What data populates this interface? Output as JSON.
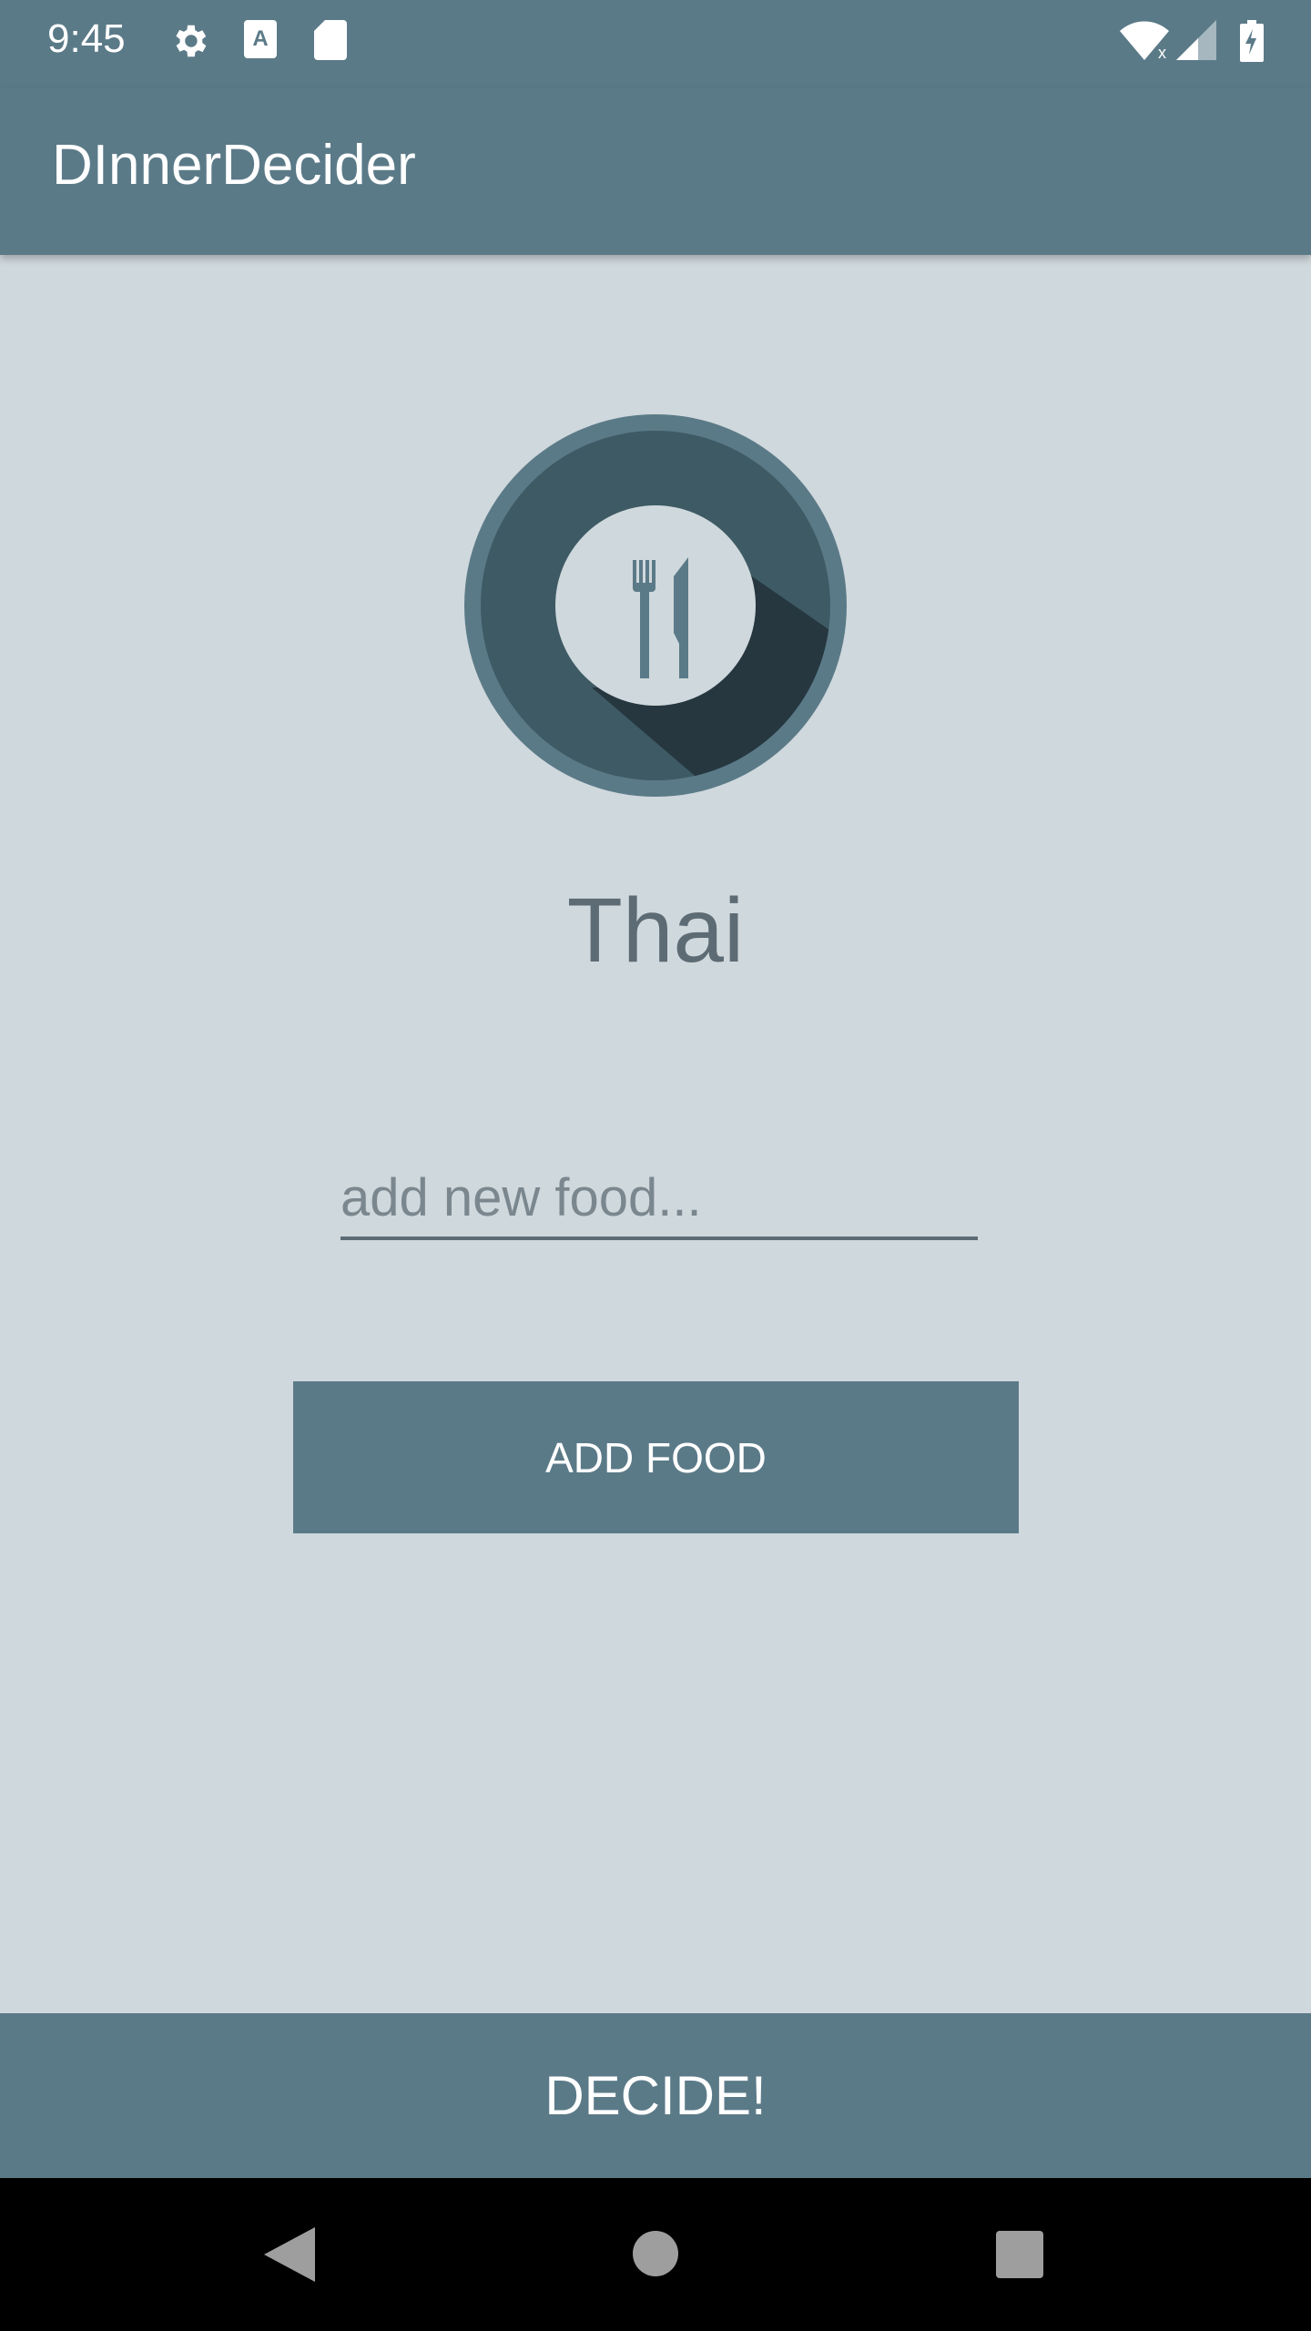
{
  "status_bar": {
    "time": "9:45",
    "icons": [
      "settings-icon",
      "font-a-icon",
      "sd-card-icon",
      "wifi-off-icon",
      "signal-icon",
      "battery-charging-icon"
    ]
  },
  "app_bar": {
    "title": "DInnerDecider"
  },
  "main": {
    "logo": "plate-fork-knife-icon",
    "selected_food": "Thai",
    "new_food_input": {
      "value": "",
      "placeholder": "add new food..."
    },
    "add_food_label": "ADD FOOD"
  },
  "decide_label": "DECIDE!",
  "nav_bar": {
    "icons": [
      "back-icon",
      "home-icon",
      "recents-icon"
    ]
  },
  "colors": {
    "primary": "#5b7a88",
    "background": "#cfd8dc",
    "text": "#5d6b74"
  }
}
